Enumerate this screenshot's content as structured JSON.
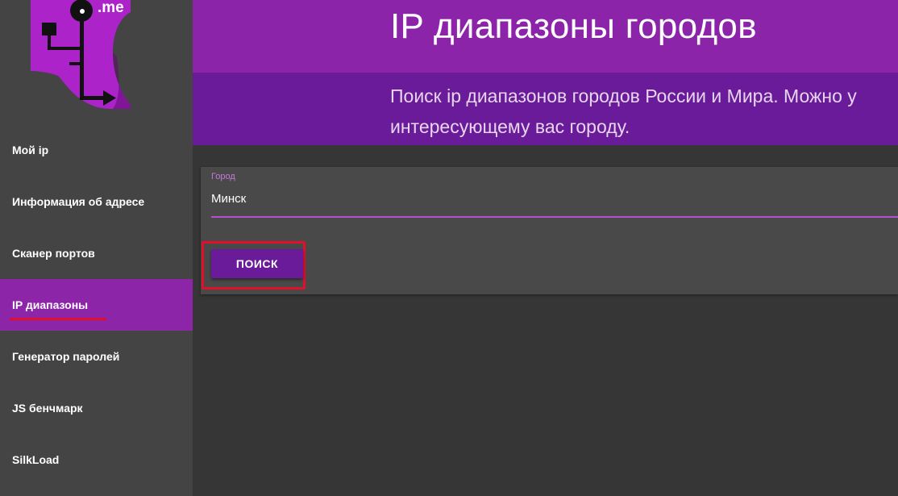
{
  "logo": {
    "text": ".me",
    "colors": {
      "bg": "#ab23c9",
      "dark": "#5c0d6e",
      "line": "#111111"
    }
  },
  "sidebar": {
    "items": [
      {
        "label": "Мой ip",
        "active": false
      },
      {
        "label": "Информация об адресе",
        "active": false
      },
      {
        "label": "Сканер портов",
        "active": false
      },
      {
        "label": "IP диапазоны",
        "active": true
      },
      {
        "label": "Генератор паролей",
        "active": false
      },
      {
        "label": "JS бенчмарк",
        "active": false
      },
      {
        "label": "SilkLoad",
        "active": false
      }
    ]
  },
  "header": {
    "title": "IP диапазоны городов",
    "description_line1": "Поиск ip диапазонов городов России и Мира. Можно у",
    "description_line2": "интересующему вас городу."
  },
  "form": {
    "city_label": "Город",
    "city_value": "Минск",
    "search_button": "ПОИСК"
  },
  "colors": {
    "sidebar_bg": "#444444",
    "active_item": "#8d25a9",
    "header_top": "#8c24aa",
    "header_bottom": "#6a1b9a",
    "page_bg": "#363636",
    "card_bg": "#494949",
    "annotation_red": "#e0102a"
  }
}
